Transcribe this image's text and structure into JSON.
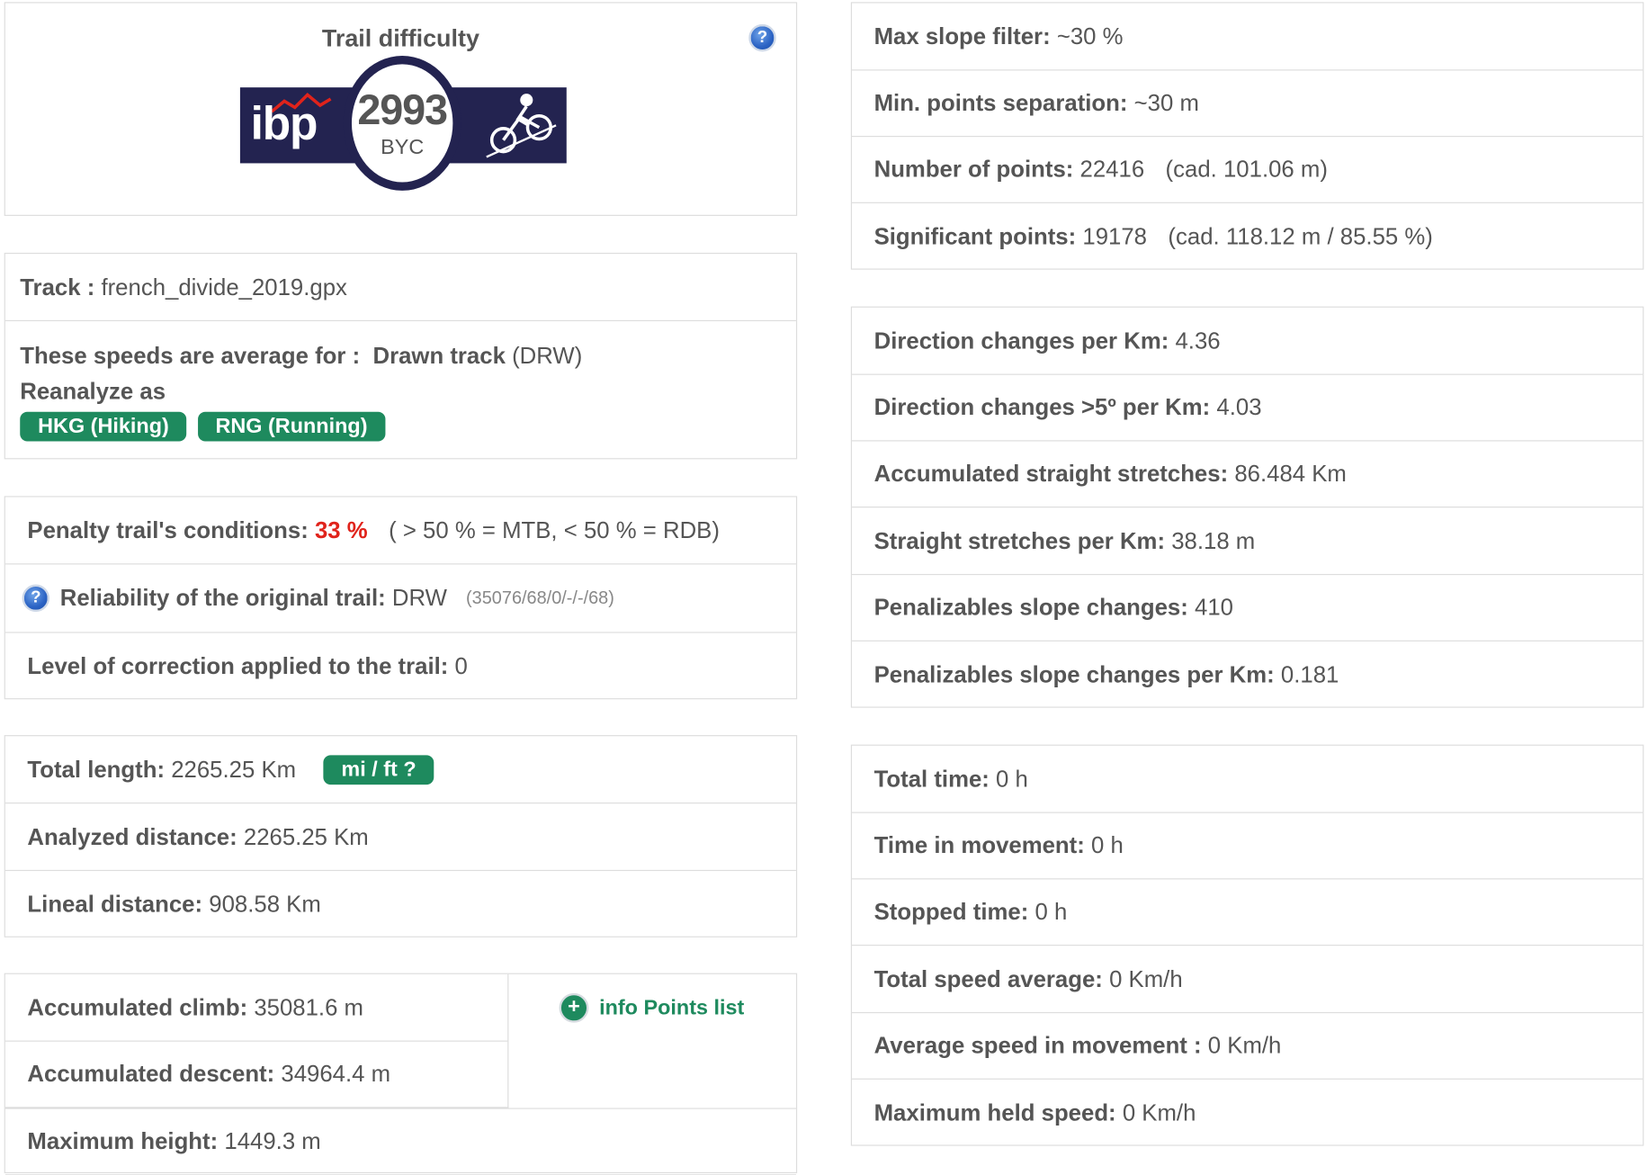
{
  "difficulty": {
    "title": "Trail difficulty",
    "logo_text": "ibp",
    "score": "2993",
    "code": "BYC"
  },
  "track": {
    "label": "Track :",
    "file": "french_divide_2019.gpx",
    "speeds_label": "These speeds are average for :",
    "drawn_label": "Drawn track",
    "drawn_code": "(DRW)",
    "reanalyze_label": "Reanalyze as",
    "hkg_button": "HKG (Hiking)",
    "rng_button": "RNG (Running)"
  },
  "conditions": {
    "penalty_label": "Penalty trail's conditions:",
    "penalty_value": "33 %",
    "penalty_note": "( > 50 % = MTB, < 50 % = RDB)",
    "reliability_label": "Reliability of the original trail:",
    "reliability_value": "DRW",
    "reliability_detail": "(35076/68/0/-/-/68)",
    "correction_label": "Level of correction applied to the trail:",
    "correction_value": "0"
  },
  "distance": {
    "total_label": "Total length:",
    "total_value": "2265.25 Km",
    "units_button": "mi / ft ?",
    "analyzed_label": "Analyzed distance:",
    "analyzed_value": "2265.25 Km",
    "lineal_label": "Lineal distance:",
    "lineal_value": "908.58 Km"
  },
  "elevation": {
    "climb_label": "Accumulated climb:",
    "climb_value": "35081.6 m",
    "descent_label": "Accumulated descent:",
    "descent_value": "34964.4 m",
    "max_label": "Maximum height:",
    "max_value": "1449.3 m",
    "info_link": "info Points list"
  },
  "filters": {
    "slope_label": "Max slope filter:",
    "slope_value": "~30 %",
    "sep_label": "Min. points separation:",
    "sep_value": "~30 m",
    "points_label": "Number of points:",
    "points_value": "22416",
    "points_note": "(cad. 101.06 m)",
    "sig_label": "Significant points:",
    "sig_value": "19178",
    "sig_note": "(cad. 118.12 m / 85.55 %)"
  },
  "direction": {
    "dir_label": "Direction changes per Km:",
    "dir_value": "4.36",
    "dir5_label": "Direction changes >5º per Km:",
    "dir5_value": "4.03",
    "straight_label": "Accumulated straight stretches:",
    "straight_value": "86.484 Km",
    "straight_km_label": "Straight stretches per Km:",
    "straight_km_value": "38.18 m",
    "pen_label": "Penalizables slope changes:",
    "pen_value": "410",
    "pen_km_label": "Penalizables slope changes per Km:",
    "pen_km_value": "0.181"
  },
  "time": {
    "total_label": "Total time:",
    "total_value": "0 h",
    "movement_label": "Time in movement:",
    "movement_value": "0 h",
    "stopped_label": "Stopped time:",
    "stopped_value": "0 h",
    "speed_label": "Total speed average:",
    "speed_value": "0 Km/h",
    "avg_move_label": "Average speed in movement :",
    "avg_move_value": "0 Km/h",
    "max_speed_label": "Maximum held speed:",
    "max_speed_value": "0 Km/h"
  },
  "colors": {
    "green": "#1e8a5e",
    "red": "#e0231b",
    "navy": "#232350"
  },
  "icons": [
    "help-icon",
    "plus-circle-icon",
    "cyclist-icon",
    "mountain-icon"
  ]
}
